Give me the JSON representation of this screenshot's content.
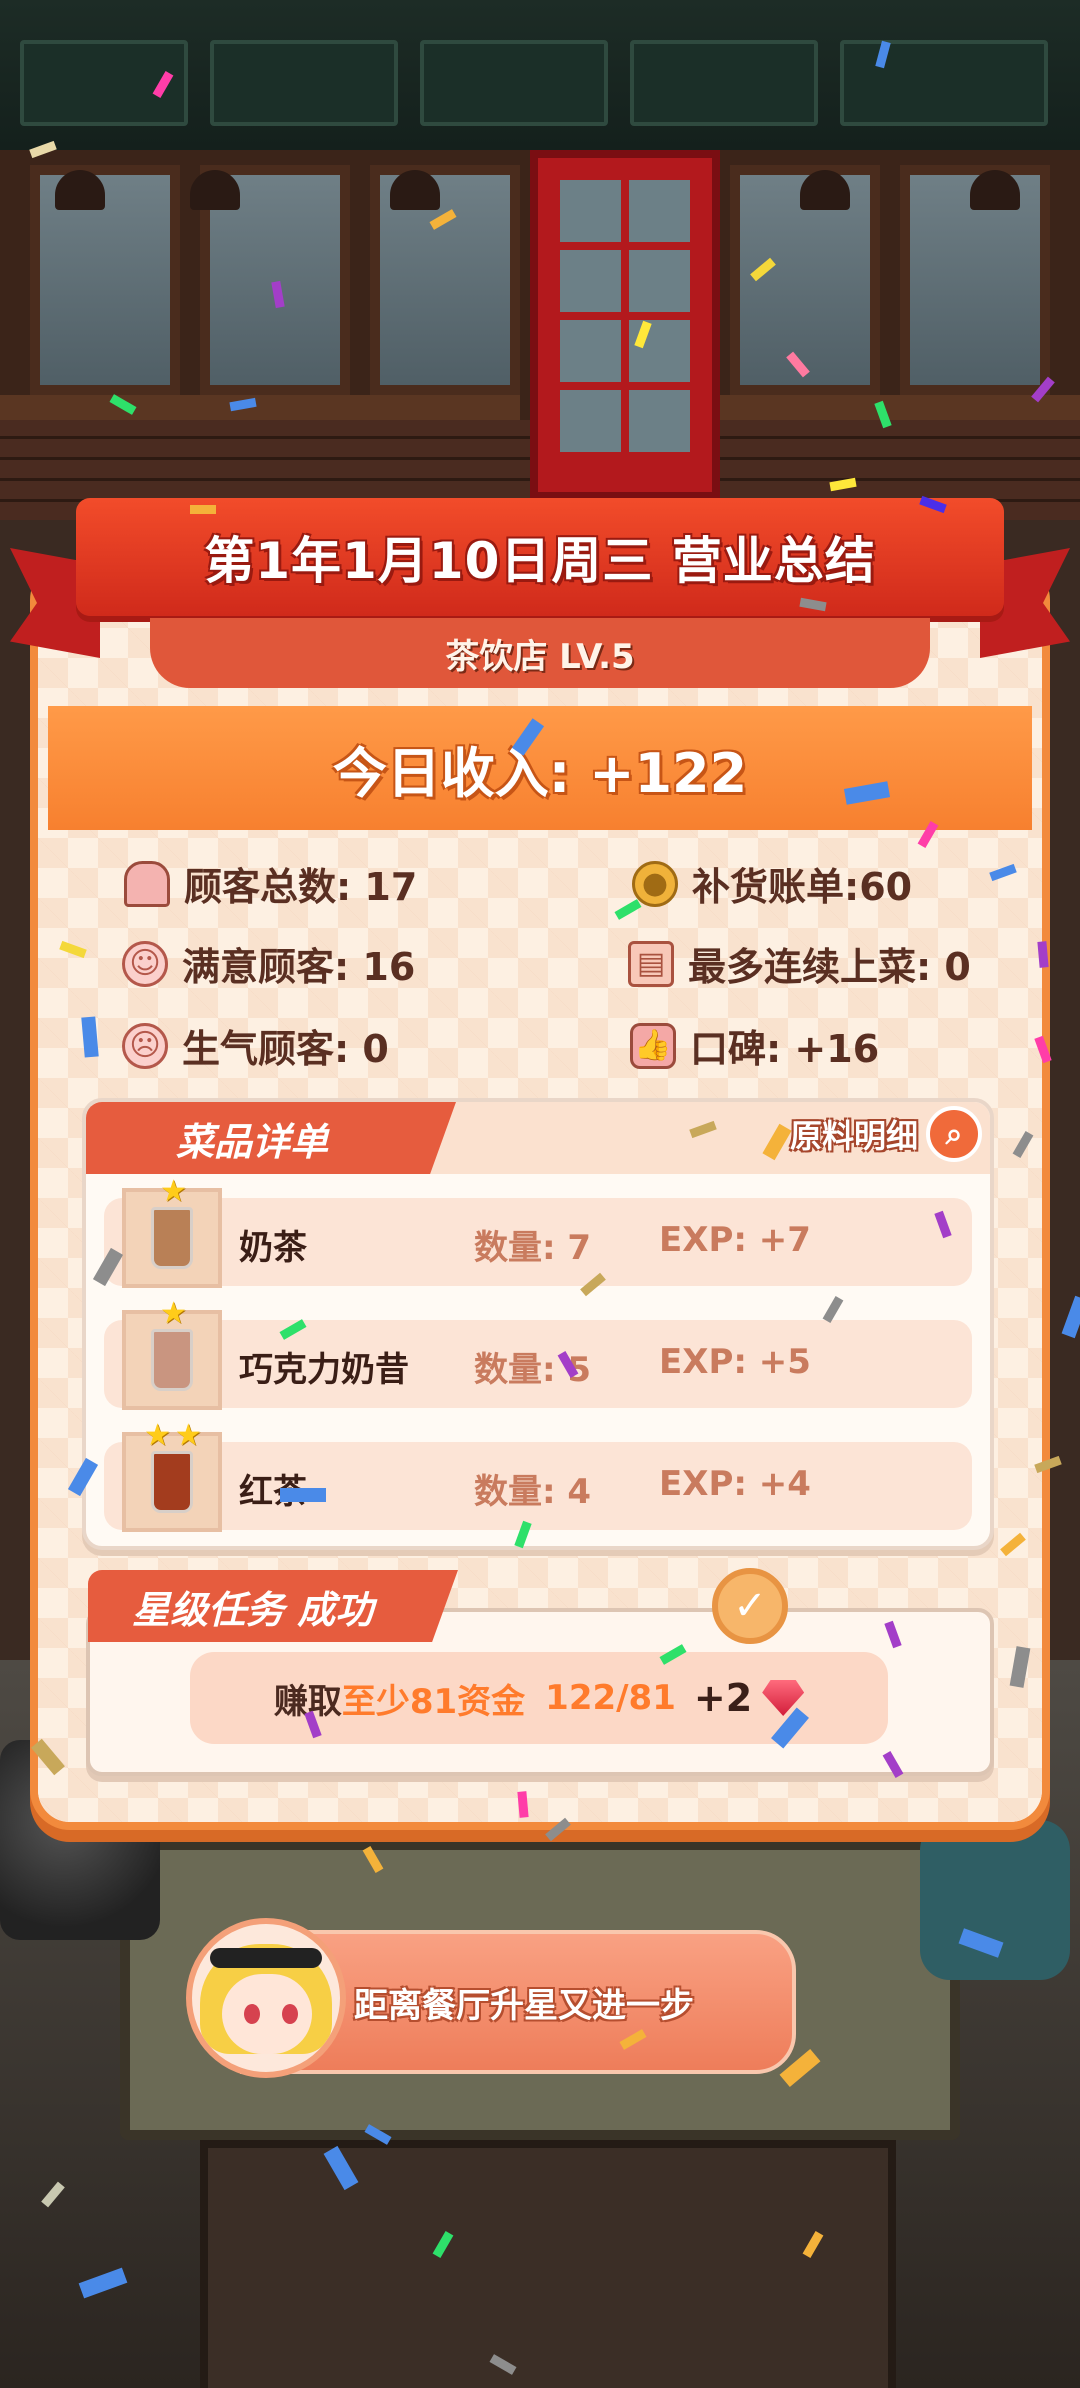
{
  "summary": {
    "title": "第1年1月10日周三 营业总结",
    "shop": "茶饮店  LV.5",
    "income": "今日收入: +122"
  },
  "stats": {
    "total_customers": "顾客总数: 17",
    "restock_bill": "补货账单:60",
    "satisfied": "满意顾客: 16",
    "max_combo": "最多连续上菜: 0",
    "angry": "生气顾客: 0",
    "reputation": "口碑: +16"
  },
  "dishes": {
    "header": "菜品详单",
    "ingredient_button": "原料明细",
    "items": [
      {
        "name": "奶茶",
        "qty": "数量: 7",
        "exp": "EXP: +7",
        "stars": 1
      },
      {
        "name": "巧克力奶昔",
        "qty": "数量: 5",
        "exp": "EXP: +5",
        "stars": 1
      },
      {
        "name": "红茶",
        "qty": "数量: 4",
        "exp": "EXP: +4",
        "stars": 2
      }
    ]
  },
  "task": {
    "title": "星级任务 成功",
    "earn": "赚取",
    "condition": "至少81资金",
    "progress": "122/81",
    "reward": "+2"
  },
  "banner": {
    "text": "距离餐厅升星又进一步"
  },
  "icons": {
    "person": "person-icon",
    "coin": "coin-icon",
    "smile": "smile-icon",
    "tray": "tray-icon",
    "angry": "angry-icon",
    "thumb": "thumbs-up-icon",
    "search": "search-icon",
    "check": "check-icon",
    "gem": "gem-icon"
  },
  "colors": {
    "ribbon": "#e23a22",
    "income_bar": "#f98a3a",
    "panel_border": "#f28a3c",
    "accent_text": "#ff7b2c"
  }
}
